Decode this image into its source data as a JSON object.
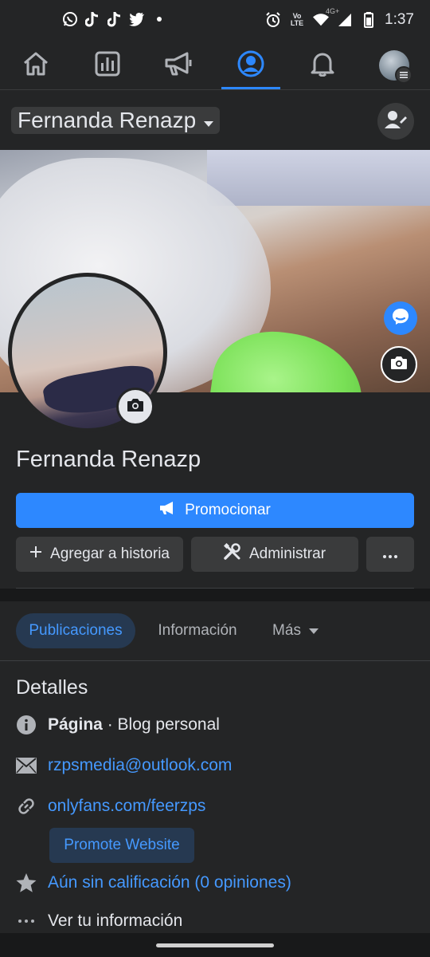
{
  "status_bar": {
    "time": "1:37",
    "left_icons": [
      "whatsapp-icon",
      "tiktok-icon",
      "tiktok-icon",
      "twitter-icon",
      "dot-icon"
    ],
    "right_icons": [
      "alarm-icon",
      "volte-icon",
      "wifi-icon",
      "signal-icon",
      "battery-icon"
    ],
    "volte_label": "Vo) LTE",
    "network_label": "4G+"
  },
  "nav": {
    "tabs": [
      {
        "name": "home",
        "icon": "home-icon"
      },
      {
        "name": "insights",
        "icon": "bar-chart-icon"
      },
      {
        "name": "ads",
        "icon": "megaphone-icon"
      },
      {
        "name": "profile",
        "icon": "profile-icon",
        "active": true
      },
      {
        "name": "notifications",
        "icon": "bell-icon"
      },
      {
        "name": "menu",
        "icon": "avatar-menu-icon"
      }
    ]
  },
  "header": {
    "page_name": "Fernanda Renazp"
  },
  "profile": {
    "name": "Fernanda Renazp"
  },
  "actions": {
    "promote_label": "Promocionar",
    "add_story_label": "Agregar a historia",
    "manage_label": "Administrar",
    "more_label": "•••"
  },
  "tabs": {
    "posts": "Publicaciones",
    "info": "Información",
    "more": "Más"
  },
  "details": {
    "title": "Detalles",
    "page_type_bold": "Página",
    "page_type_rest": " · Blog personal",
    "email": "rzpsmedia@outlook.com",
    "website": "onlyfans.com/feerzps",
    "promote_website": "Promote Website",
    "rating": "Aún sin calificación (0 opiniones)",
    "see_info": "Ver tu información"
  },
  "colors": {
    "background": "#242526",
    "accent": "#2d88ff",
    "link": "#4599ff",
    "secondary_button": "#3a3b3c"
  }
}
